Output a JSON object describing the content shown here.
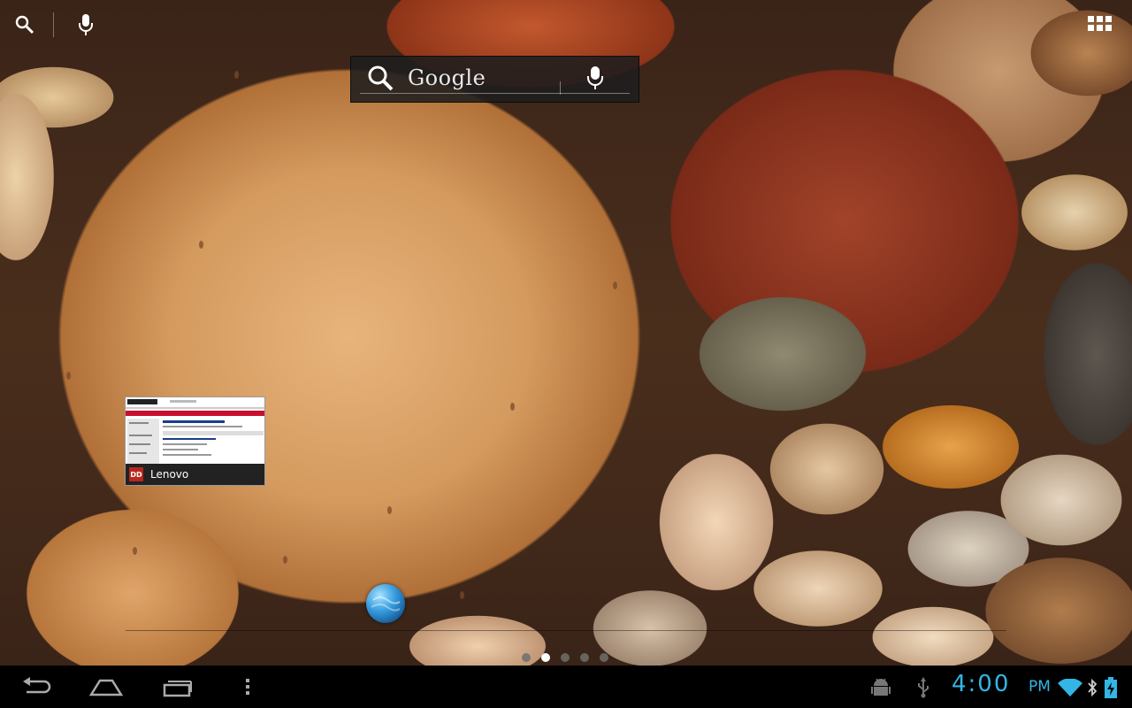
{
  "top_bar": {
    "search_icon": "search-icon",
    "voice_icon": "mic-icon",
    "apps_icon": "apps-grid-icon"
  },
  "google_search": {
    "label": "Google",
    "search_icon": "search-icon",
    "voice_icon": "mic-icon"
  },
  "widget": {
    "label": "Lenovo",
    "badge": "DD"
  },
  "home": {
    "app_icon": "browser-globe-icon",
    "page_indicator": {
      "pages": 5,
      "current": 2
    }
  },
  "navbar": {
    "back_icon": "back-icon",
    "home_icon": "home-icon",
    "recent_icon": "recent-apps-icon",
    "menu_icon": "menu-icon"
  },
  "status": {
    "time": "4:00",
    "ampm": "PM",
    "icons": [
      "android-debug-icon",
      "usb-icon",
      "wifi-icon",
      "bluetooth-icon",
      "battery-charging-icon"
    ],
    "accent_color": "#33b5e5"
  }
}
